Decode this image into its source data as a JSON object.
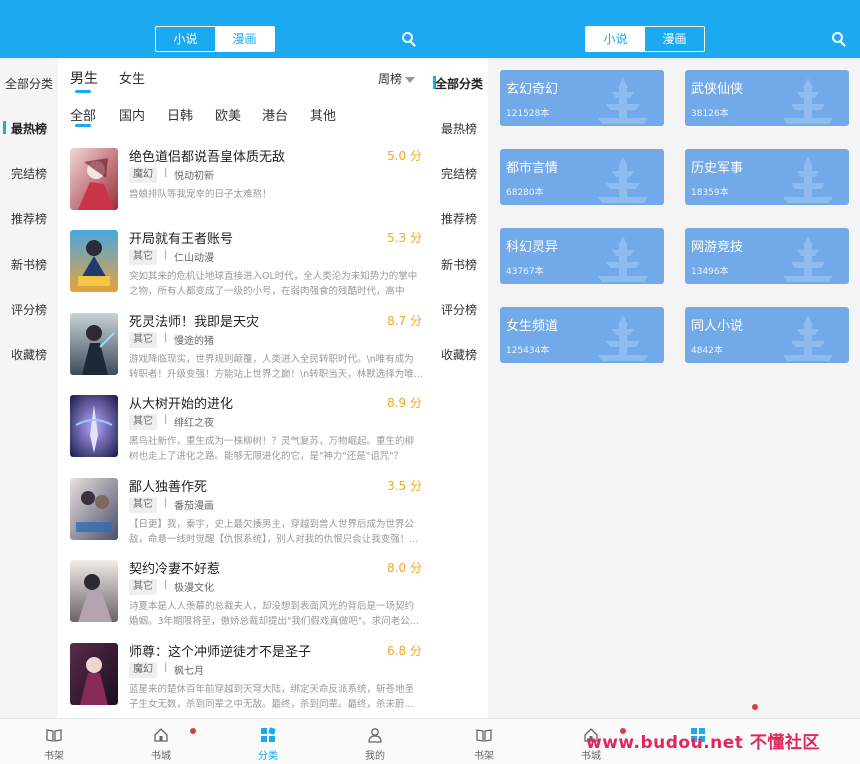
{
  "colors": {
    "accent": "#1ba9ef",
    "score": "#f5a623",
    "card": "#72a9e8",
    "badge_dot": "#e53935",
    "watermark": "#e0285a"
  },
  "left": {
    "segment": {
      "novel": "小说",
      "comic": "漫画",
      "active": "漫画"
    },
    "search_icon": "search-icon",
    "sidebar": [
      "全部分类",
      "最热榜",
      "完结榜",
      "推荐榜",
      "新书榜",
      "评分榜",
      "收藏榜"
    ],
    "gender": {
      "male": "男生",
      "female": "女生"
    },
    "rank_sort": "周榜",
    "regions": [
      "全部",
      "国内",
      "日韩",
      "欧美",
      "港台",
      "其他"
    ],
    "books": [
      {
        "title": "绝色道侣都说吾皇体质无敌",
        "score": "5.0 分",
        "tag": "魔幻",
        "author": "悦动初新",
        "desc": "兽娘排队等我宠幸的日子太难熬！"
      },
      {
        "title": "开局就有王者账号",
        "score": "5.3 分",
        "tag": "其它",
        "author": "仁山动漫",
        "desc": "突如其来的危机让地球直接进入OL时代，全人类沦为未知势力的掌中之物，所有人都变成了一级的小号，在弱肉强食的残酷时代，高中生..."
      },
      {
        "title": "死灵法师！我即是天灾",
        "score": "8.7 分",
        "tag": "其它",
        "author": "慢途的猪",
        "desc": "游戏降临现实，世界规则颠覆，人类进入全民转职时代。\\n唯有成为转职者！升级变强！方能站上世界之巅！\\n转职当天，林默选择为唯..."
      },
      {
        "title": "从大树开始的进化",
        "score": "8.9 分",
        "tag": "其它",
        "author": "绯红之夜",
        "desc": "黑鸟社新作，重生成为一株柳树！？灵气复苏，万物崛起。重生的柳树也走上了进化之路。能够无限进化的它，是\"神力\"还是\"诅咒\"？"
      },
      {
        "title": "鄙人独善作死",
        "score": "3.5 分",
        "tag": "其它",
        "author": "番茄漫画",
        "desc": "【日更】我，秦宇，史上最欠揍男主，穿越到兽人世界后成为世界公敌，命悬一线时觉醒【仇恨系统】，别人对我的仇恨只会让我变强！..."
      },
      {
        "title": "契约冷妻不好惹",
        "score": "8.0 分",
        "tag": "其它",
        "author": "极漫文化",
        "desc": "诗夏本是人人羡慕的总裁夫人，却没想到表面风光的背后是一场契约婚姻。3年期限将至，傲娇总裁却提出\"我们假戏真做吧\"。求问老公..."
      },
      {
        "title": "师尊：这个冲师逆徒才不是圣子",
        "score": "6.8 分",
        "tag": "魔幻",
        "author": "枫七月",
        "desc": "蓝星来的楚休百年前穿越到天穹大陆，绑定天命反派系统，斩苍地圣子生女无数，杀到同辈之中无敌。最终，杀到同辈。最终，杀未蔚..."
      }
    ],
    "tabs": [
      "书架",
      "书城",
      "分类",
      "我的"
    ],
    "active_tab": "分类"
  },
  "right": {
    "segment": {
      "novel": "小说",
      "comic": "漫画",
      "active": "小说"
    },
    "sidebar": [
      "全部分类",
      "最热榜",
      "完结榜",
      "推荐榜",
      "新书榜",
      "评分榜",
      "收藏榜"
    ],
    "categories": [
      {
        "name": "玄幻奇幻",
        "count": "121528本"
      },
      {
        "name": "武侠仙侠",
        "count": "38126本"
      },
      {
        "name": "都市言情",
        "count": "68280本"
      },
      {
        "name": "历史军事",
        "count": "18359本"
      },
      {
        "name": "科幻灵异",
        "count": "43767本"
      },
      {
        "name": "网游竞技",
        "count": "13496本"
      },
      {
        "name": "女生频道",
        "count": "125434本"
      },
      {
        "name": "同人小说",
        "count": "4842本"
      }
    ],
    "tabs": [
      "书架",
      "书城"
    ]
  },
  "watermark": "www.budou.net 不懂社区"
}
